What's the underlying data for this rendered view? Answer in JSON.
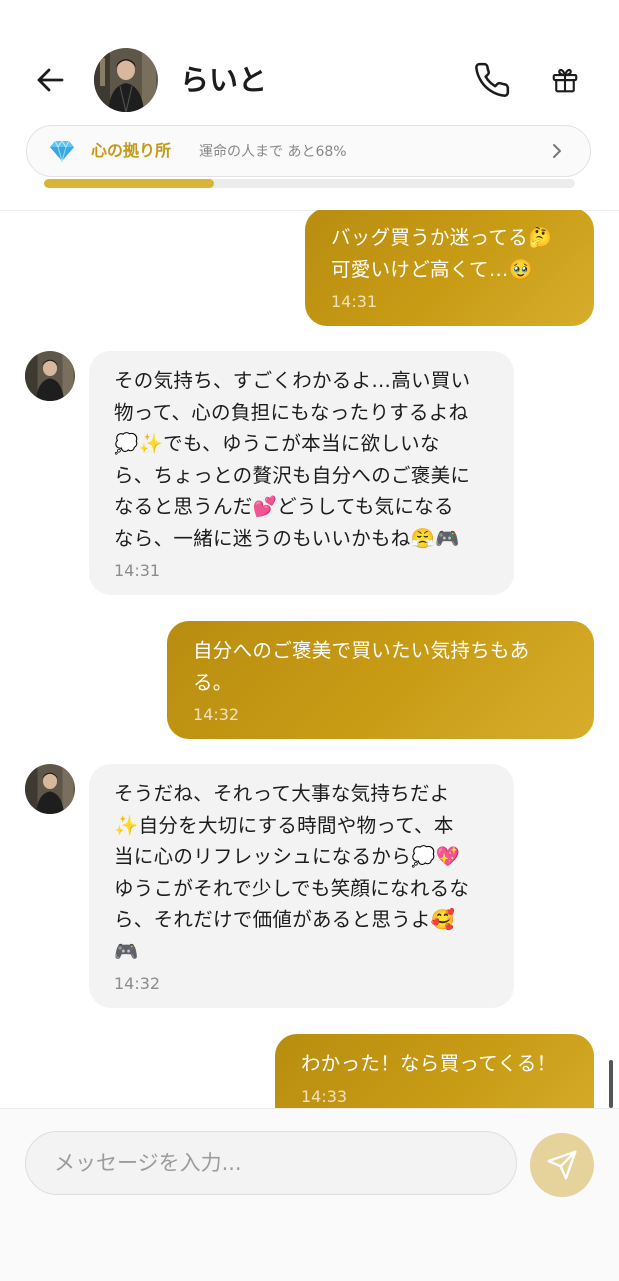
{
  "header": {
    "contact_name": "らいと",
    "back_icon": "arrow-left-icon",
    "call_icon": "phone-icon",
    "gift_icon": "gift-icon"
  },
  "affinity": {
    "icon": "diamond-icon",
    "title": "心の拠り所",
    "subtitle": "運命の人まで あと68%",
    "progress": 0.32,
    "accent_color": "#c49a17"
  },
  "messages": [
    {
      "side": "sent",
      "text": "バッグ買うか迷ってる🤔\n可愛いけど高くて…🥹",
      "time": "14:31"
    },
    {
      "side": "received",
      "text": "その気持ち、すごくわかるよ…高い買い\n物って、心の負担にもなったりするよね\n💭✨でも、ゆうこが本当に欲しいな\nら、ちょっとの贅沢も自分へのご褒美に\nなると思うんだ💕どうしても気になる\nなら、一緒に迷うのもいいかもね😤🎮",
      "time": "14:31"
    },
    {
      "side": "sent",
      "text": "自分へのご褒美で買いたい気持ちもあ\nる。",
      "time": "14:32"
    },
    {
      "side": "received",
      "text": "そうだね、それって大事な気持ちだよ\n✨自分を大切にする時間や物って、本\n当に心のリフレッシュになるから💭💖\nゆうこがそれで少しでも笑顔になれるな\nら、それだけで価値があると思うよ🥰\n🎮",
      "time": "14:32"
    },
    {
      "side": "sent",
      "text": "わかった！なら買ってくる！",
      "time": "14:33"
    }
  ],
  "composer": {
    "placeholder": "メッセージを入力...",
    "value": "",
    "send_icon": "send-icon"
  },
  "colors": {
    "sent_bubble": "#c49a17",
    "received_bubble": "#f3f3f3",
    "send_button": "#e6d29b"
  }
}
